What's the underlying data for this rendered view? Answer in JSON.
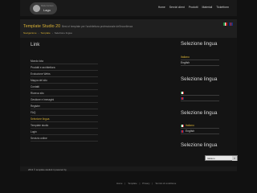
{
  "brand": {
    "subtitle": "Mattia Sorbetti",
    "name": "Lago"
  },
  "nav": [
    "Home",
    "Servizi client",
    "Prodotti",
    "Materiali",
    "Ticketform"
  ],
  "page": {
    "title": "Template Studio 20",
    "tagline": "Best of template per l'architettura professionale dell'eccellenza",
    "breadcrumb": [
      "Navigazione",
      "Template",
      "Selezione lingua"
    ]
  },
  "links_section": {
    "title": "Link",
    "items": [
      "Mondo Iota",
      "Prodotti e architettura",
      "Evoluzione Webs",
      "Mappa del sito",
      "Contatti",
      "Ricerca sito",
      "Gestione e immagini",
      "Register",
      "FAQ",
      "Selezione lingua",
      "Template studio",
      "Login",
      "Servizio online"
    ],
    "active_index": 9
  },
  "sidebar": {
    "blocks": [
      {
        "title": "Selezione lingua",
        "items": [
          "Italiano",
          "English"
        ]
      },
      {
        "title": "Selezione lingua",
        "items": [
          "",
          ""
        ]
      },
      {
        "title": "Selezione lingua",
        "items": [
          "Italiano",
          "English"
        ]
      },
      {
        "title": "Selezione lingua",
        "select_value": "Italiano"
      }
    ]
  },
  "footer": {
    "copyright": "2013 © template.studio2.it powered by",
    "links": [
      "Home",
      "Template",
      "Privacy",
      "Termini di condizione"
    ]
  },
  "colors": {
    "accent": "#d7b035",
    "background": "#111111",
    "panel": "#141414"
  }
}
